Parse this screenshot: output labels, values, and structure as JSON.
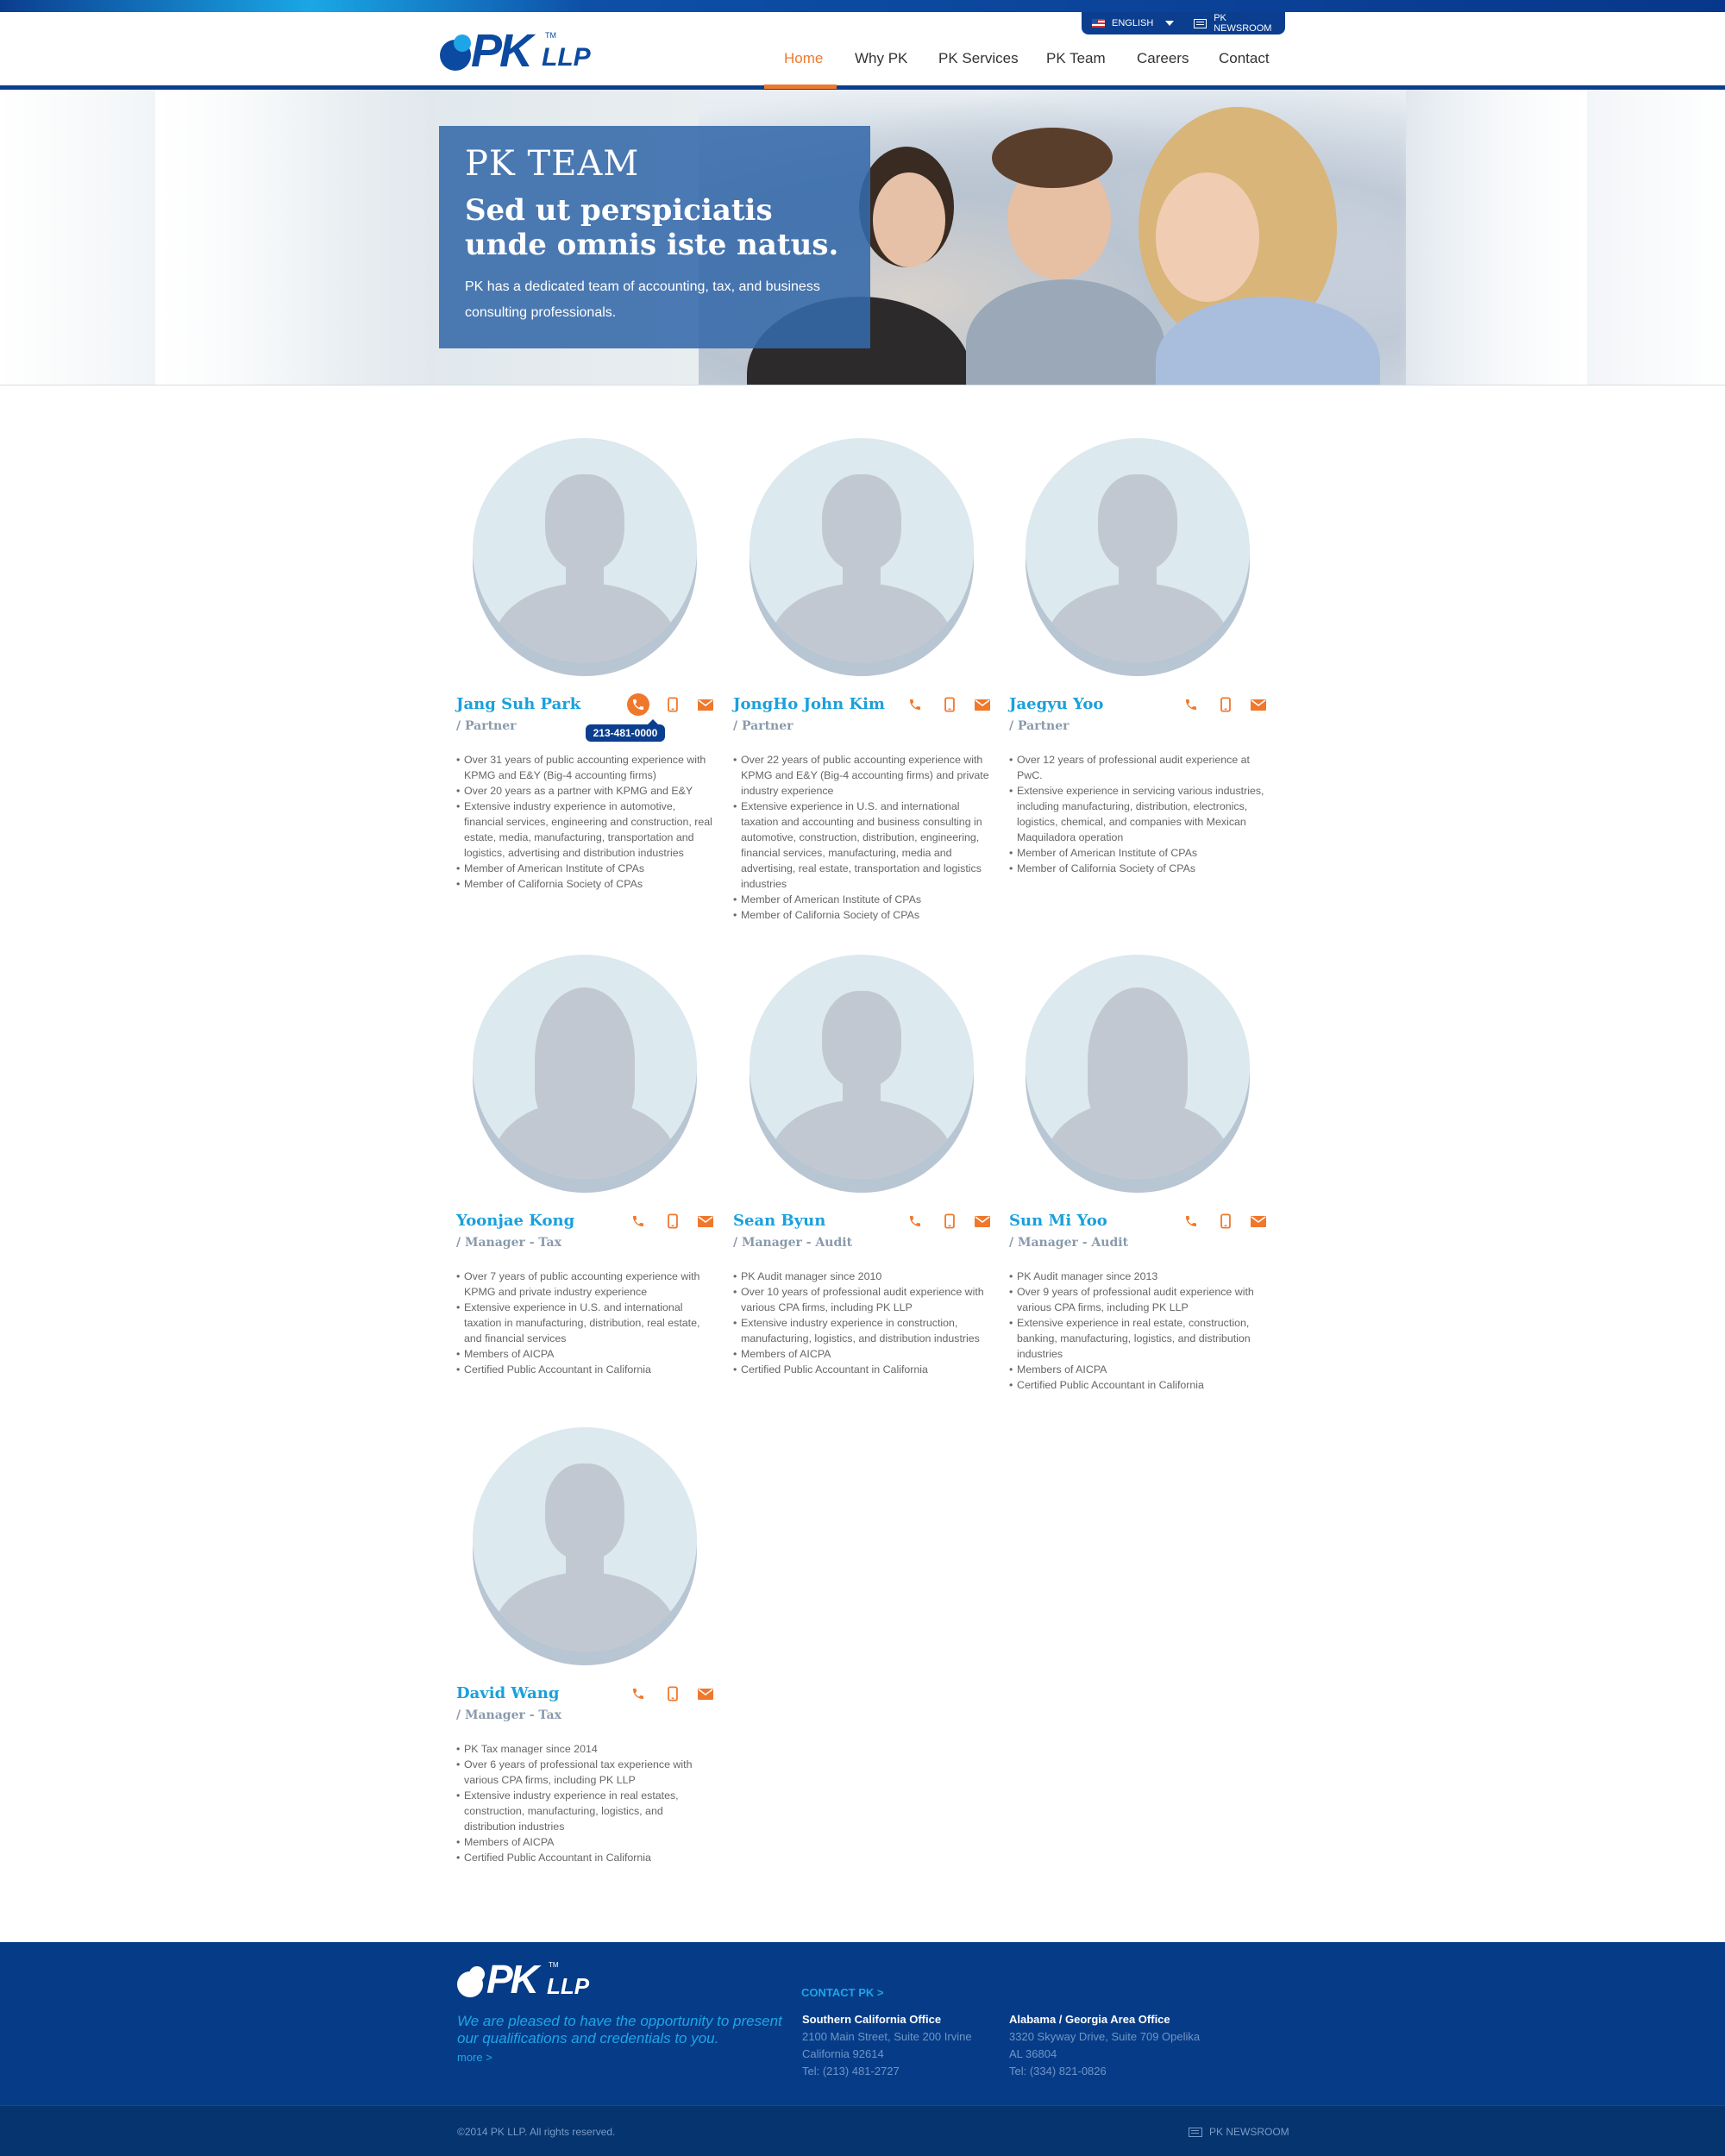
{
  "header": {
    "logo_text": "PK",
    "logo_suffix": "LLP",
    "logo_tm": "TM",
    "language": "ENGLISH",
    "newsroom": "PK NEWSROOM",
    "nav": [
      {
        "label": "Home",
        "active": true
      },
      {
        "label": "Why PK",
        "active": false
      },
      {
        "label": "PK Services",
        "active": false
      },
      {
        "label": "PK Team",
        "active": false
      },
      {
        "label": "Careers",
        "active": false
      },
      {
        "label": "Contact",
        "active": false
      }
    ],
    "accent_color": "#f0782d",
    "brand_color": "#0b3e8e"
  },
  "hero": {
    "kicker": "PK TEAM",
    "title": "Sed ut perspiciatis unde omnis iste natus.",
    "description": "PK has a dedicated team of accounting, tax, and business consulting professionals."
  },
  "team": [
    {
      "name": "Jang Suh Park",
      "role": "/ Partner",
      "silhouette": "male",
      "phone_tooltip": "213-481-0000",
      "bio": [
        "Over 31 years of public accounting experience with KPMG and E&Y (Big-4 accounting firms)",
        "Over 20 years as a partner with KPMG and E&Y",
        "Extensive industry experience in automotive, financial services, engineering and construction, real estate, media, manufacturing, transportation and logistics, advertising and distribution industries",
        "Member of American Institute of CPAs",
        "Member of California Society of CPAs"
      ]
    },
    {
      "name": "JongHo John Kim",
      "role": "/ Partner",
      "silhouette": "male",
      "bio": [
        "Over 22 years of public accounting experience with KPMG and E&Y (Big-4 accounting firms) and private industry experience",
        "Extensive experience in U.S. and international taxation and accounting and business consulting in automotive, construction, distribution, engineering, financial services, manufacturing, media and advertising, real estate, transportation and logistics industries",
        "Member of American Institute of CPAs",
        "Member of California Society of CPAs"
      ]
    },
    {
      "name": "Jaegyu Yoo",
      "role": "/ Partner",
      "silhouette": "male",
      "bio": [
        "Over 12 years of professional audit experience at PwC.",
        "Extensive experience in servicing various industries, including manufacturing, distribution, electronics, logistics, chemical, and companies with Mexican Maquiladora operation",
        "Member of American Institute of CPAs",
        "Member of California Society of CPAs"
      ]
    },
    {
      "name": "Yoonjae Kong",
      "role": "/ Manager - Tax",
      "silhouette": "female",
      "bio": [
        "Over 7 years of public accounting experience with KPMG and private industry experience",
        "Extensive experience in U.S. and international taxation in manufacturing, distribution, real estate, and financial services",
        "Members of AICPA",
        "Certified Public Accountant in California"
      ]
    },
    {
      "name": "Sean Byun",
      "role": "/ Manager - Audit",
      "silhouette": "male",
      "bio": [
        "PK Audit manager since 2010",
        "Over 10 years of professional audit experience with various CPA firms, including PK LLP",
        "Extensive industry experience in construction, manufacturing, logistics, and distribution industries",
        "Members of AICPA",
        "Certified Public Accountant in California"
      ]
    },
    {
      "name": "Sun Mi Yoo",
      "role": "/ Manager - Audit",
      "silhouette": "female",
      "bio": [
        "PK Audit manager since 2013",
        "Over 9 years of professional audit experience with various CPA firms, including PK LLP",
        "Extensive experience in real estate, construction, banking, manufacturing, logistics, and distribution industries",
        "Members of AICPA",
        "Certified Public Accountant in California"
      ]
    },
    {
      "name": "David Wang",
      "role": "/ Manager - Tax",
      "silhouette": "male",
      "bio": [
        "PK Tax manager since 2014",
        "Over 6 years of professional tax experience with various CPA firms, including PK LLP",
        "Extensive industry experience in real estates, construction, manufacturing, logistics, and distribution industries",
        "Members of AICPA",
        "Certified Public Accountant in California"
      ]
    }
  ],
  "icons": [
    "phone-icon",
    "mobile-icon",
    "mail-icon"
  ],
  "footer": {
    "logo_text": "PK",
    "logo_suffix": "LLP",
    "logo_tm": "TM",
    "tagline": "We are pleased to have the opportunity to present our qualifications and credentials to you.",
    "more": "more >",
    "contact_link": "CONTACT PK >",
    "offices": [
      {
        "title": "Southern California Office",
        "lines": [
          "2100 Main Street, Suite 200 Irvine",
          "California 92614",
          "Tel: (213) 481-2727"
        ]
      },
      {
        "title": "Alabama / Georgia Area Office",
        "lines": [
          "3320 Skyway Drive, Suite 709 Opelika",
          "AL 36804",
          "Tel: (334) 821-0826"
        ]
      }
    ],
    "copyright": "©2014 PK LLP.  All rights reserved.",
    "newsroom": "PK NEWSROOM"
  }
}
